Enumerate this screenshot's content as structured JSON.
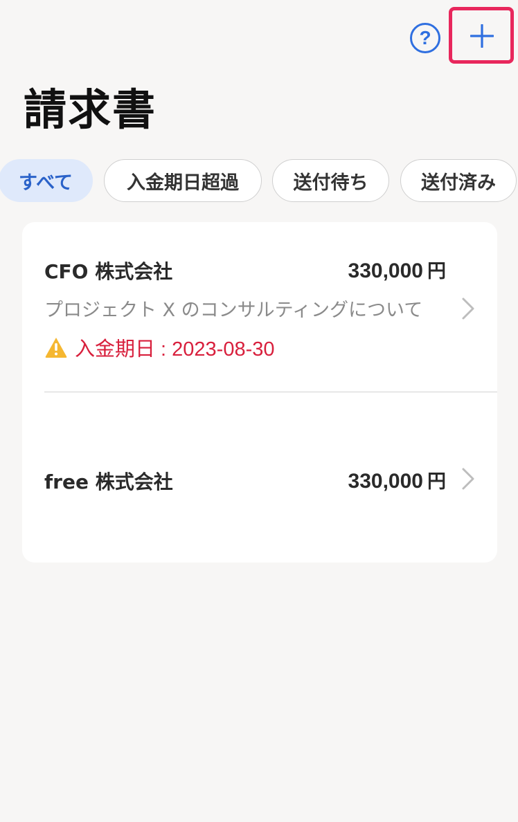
{
  "header": {
    "help_label": "?",
    "title": "請求書"
  },
  "filters": [
    {
      "label": "すべて",
      "active": true
    },
    {
      "label": "入金期日超過",
      "active": false
    },
    {
      "label": "送付待ち",
      "active": false
    },
    {
      "label": "送付済み",
      "active": false
    }
  ],
  "invoices": [
    {
      "company": "CFO 株式会社",
      "amount": "330,000",
      "currency": "円",
      "description": "プロジェクト X のコンサルティングについて",
      "due_label": "入金期日 : 2023-08-30"
    },
    {
      "company": "free 株式会社",
      "amount": "330,000",
      "currency": "円"
    }
  ],
  "colors": {
    "accent": "#2f6fe0",
    "highlight_border": "#e8275c",
    "overdue": "#d81f3c",
    "warning": "#f5b731"
  },
  "icons": {
    "help": "question-circle-icon",
    "add": "plus-icon",
    "chevron": "chevron-right-icon",
    "warning": "warning-triangle-icon"
  }
}
